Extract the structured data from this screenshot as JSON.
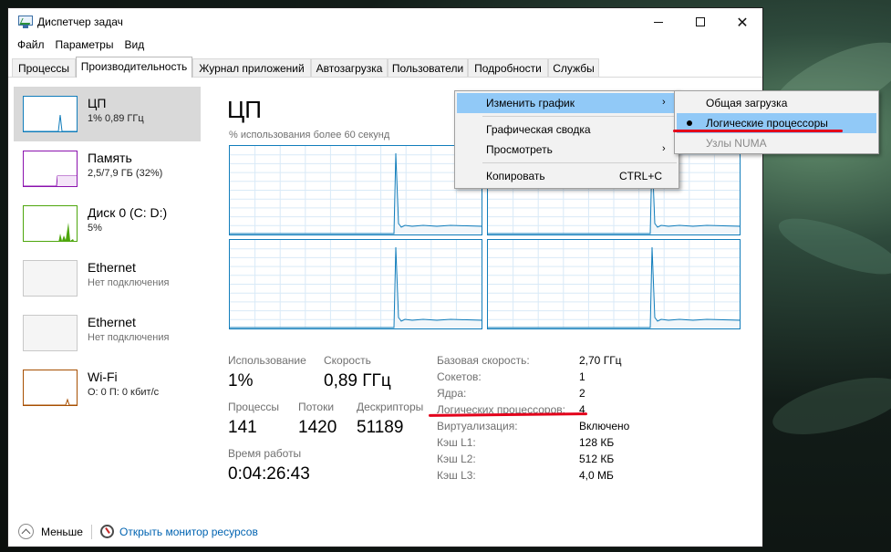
{
  "window": {
    "title": "Диспетчер задач"
  },
  "menu": [
    "Файл",
    "Параметры",
    "Вид"
  ],
  "tabs": [
    "Процессы",
    "Производительность",
    "Журнал приложений",
    "Автозагрузка",
    "Пользователи",
    "Подробности",
    "Службы"
  ],
  "sidebar": [
    {
      "title": "ЦП",
      "sub": "1% 0,89 ГГц",
      "color": "#117dbb"
    },
    {
      "title": "Память",
      "sub": "2,5/7,9 ГБ (32%)",
      "color": "#8b12ae"
    },
    {
      "title": "Диск 0 (C: D:)",
      "sub": "5%",
      "color": "#4da60c"
    },
    {
      "title": "Ethernet",
      "sub": "Нет подключения",
      "color": "#a0a0a0"
    },
    {
      "title": "Ethernet",
      "sub": "Нет подключения",
      "color": "#a0a0a0"
    },
    {
      "title": "Wi-Fi",
      "sub": "О: 0 П: 0 кбит/с",
      "color": "#a74f01"
    }
  ],
  "main": {
    "title": "ЦП",
    "graph_label": "% использования более 60 секунд",
    "stats": {
      "usage_label": "Использование",
      "usage_value": "1%",
      "speed_label": "Скорость",
      "speed_value": "0,89 ГГц",
      "processes_label": "Процессы",
      "processes_value": "141",
      "threads_label": "Потоки",
      "threads_value": "1420",
      "handles_label": "Дескрипторы",
      "handles_value": "51189",
      "uptime_label": "Время работы",
      "uptime_value": "0:04:26:43"
    },
    "info": [
      {
        "label": "Базовая скорость:",
        "value": "2,70 ГГц"
      },
      {
        "label": "Сокетов:",
        "value": "1"
      },
      {
        "label": "Ядра:",
        "value": "2"
      },
      {
        "label": "Логических процессоров:",
        "value": "4"
      },
      {
        "label": "Виртуализация:",
        "value": "Включено"
      },
      {
        "label": "Кэш L1:",
        "value": "128 КБ"
      },
      {
        "label": "Кэш L2:",
        "value": "512 КБ"
      },
      {
        "label": "Кэш L3:",
        "value": "4,0 МБ"
      }
    ]
  },
  "footer": {
    "fewer": "Меньше",
    "resource_monitor": "Открыть монитор ресурсов"
  },
  "context_menu": {
    "change_graph": "Изменить график",
    "summary": "Графическая сводка",
    "view": "Просмотреть",
    "copy": "Копировать",
    "copy_shortcut": "CTRL+C"
  },
  "submenu": {
    "overall": "Общая загрузка",
    "logical": "Логические процессоры",
    "numa": "Узлы NUMA"
  }
}
